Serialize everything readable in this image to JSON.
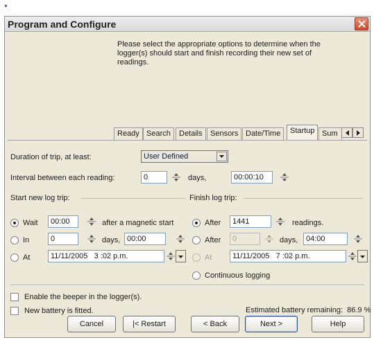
{
  "dialog": {
    "title": "Program and Configure",
    "intro": "Please select the appropriate options to determine when the logger(s) should start and finish recording their new set of readings."
  },
  "tabs": [
    {
      "label": "Ready",
      "active": false
    },
    {
      "label": "Search",
      "active": false
    },
    {
      "label": "Details",
      "active": false
    },
    {
      "label": "Sensors",
      "active": false
    },
    {
      "label": "Date/Time",
      "active": false
    },
    {
      "label": "Startup",
      "active": true
    },
    {
      "label": "Sum",
      "active": false
    }
  ],
  "startup": {
    "duration_label": "Duration of trip, at least:",
    "duration_value": "User Defined",
    "interval_label": "Interval between each reading:",
    "interval_days": "0",
    "days_text": "days,",
    "interval_time": "00:00:10",
    "start_group": "Start new log trip:",
    "finish_group": "Finish log trip:",
    "start_options": [
      {
        "label": "Wait",
        "value": "00:00",
        "suffix": "after a magnetic start",
        "checked": true
      },
      {
        "label": "In",
        "value": "0",
        "suffix": "days,",
        "time": "00:00",
        "checked": false
      },
      {
        "label": "At",
        "value": "11/11/2005   3 :02 p.m.",
        "checked": false
      }
    ],
    "finish_options": [
      {
        "label": "After",
        "value": "1441",
        "suffix": "readings.",
        "checked": true
      },
      {
        "label": "After",
        "value": "0",
        "suffix": "days,",
        "time": "04:00",
        "checked": false
      },
      {
        "label": "At",
        "value": "11/11/2005   7 :02 p.m.",
        "checked": false
      },
      {
        "label": "Continuous logging",
        "checked": false
      }
    ]
  },
  "options": {
    "beeper": "Enable the beeper in the logger(s).",
    "battery_fitted": "New battery is fitted.",
    "battery_remaining": "Estimated battery remaining:  86.9 %"
  },
  "buttons": {
    "cancel": "Cancel",
    "restart": "|< Restart",
    "back": "< Back",
    "next": "Next >",
    "help": "Help"
  },
  "colors": {
    "window_bg": "#ece9d8",
    "close_button": "#d14a2a",
    "default_button_border": "#2a4f9a"
  }
}
